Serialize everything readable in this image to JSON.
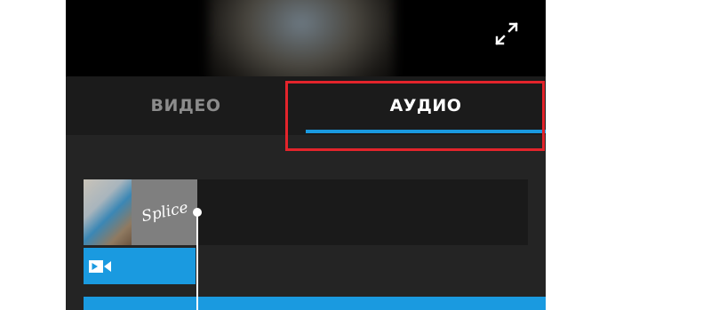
{
  "tabs": {
    "video_label": "ВИДЕО",
    "audio_label": "АУДИО",
    "active": "audio"
  },
  "timeline": {
    "clip_logo_text": "Splice"
  },
  "icons": {
    "fullscreen": "expand-arrows-icon",
    "video_track": "video-camera-icon"
  },
  "colors": {
    "accent": "#1a9ae0",
    "highlight": "#e3242b",
    "background": "#222222",
    "active_tab_text": "#ffffff",
    "inactive_tab_text": "#8c8c8c"
  }
}
